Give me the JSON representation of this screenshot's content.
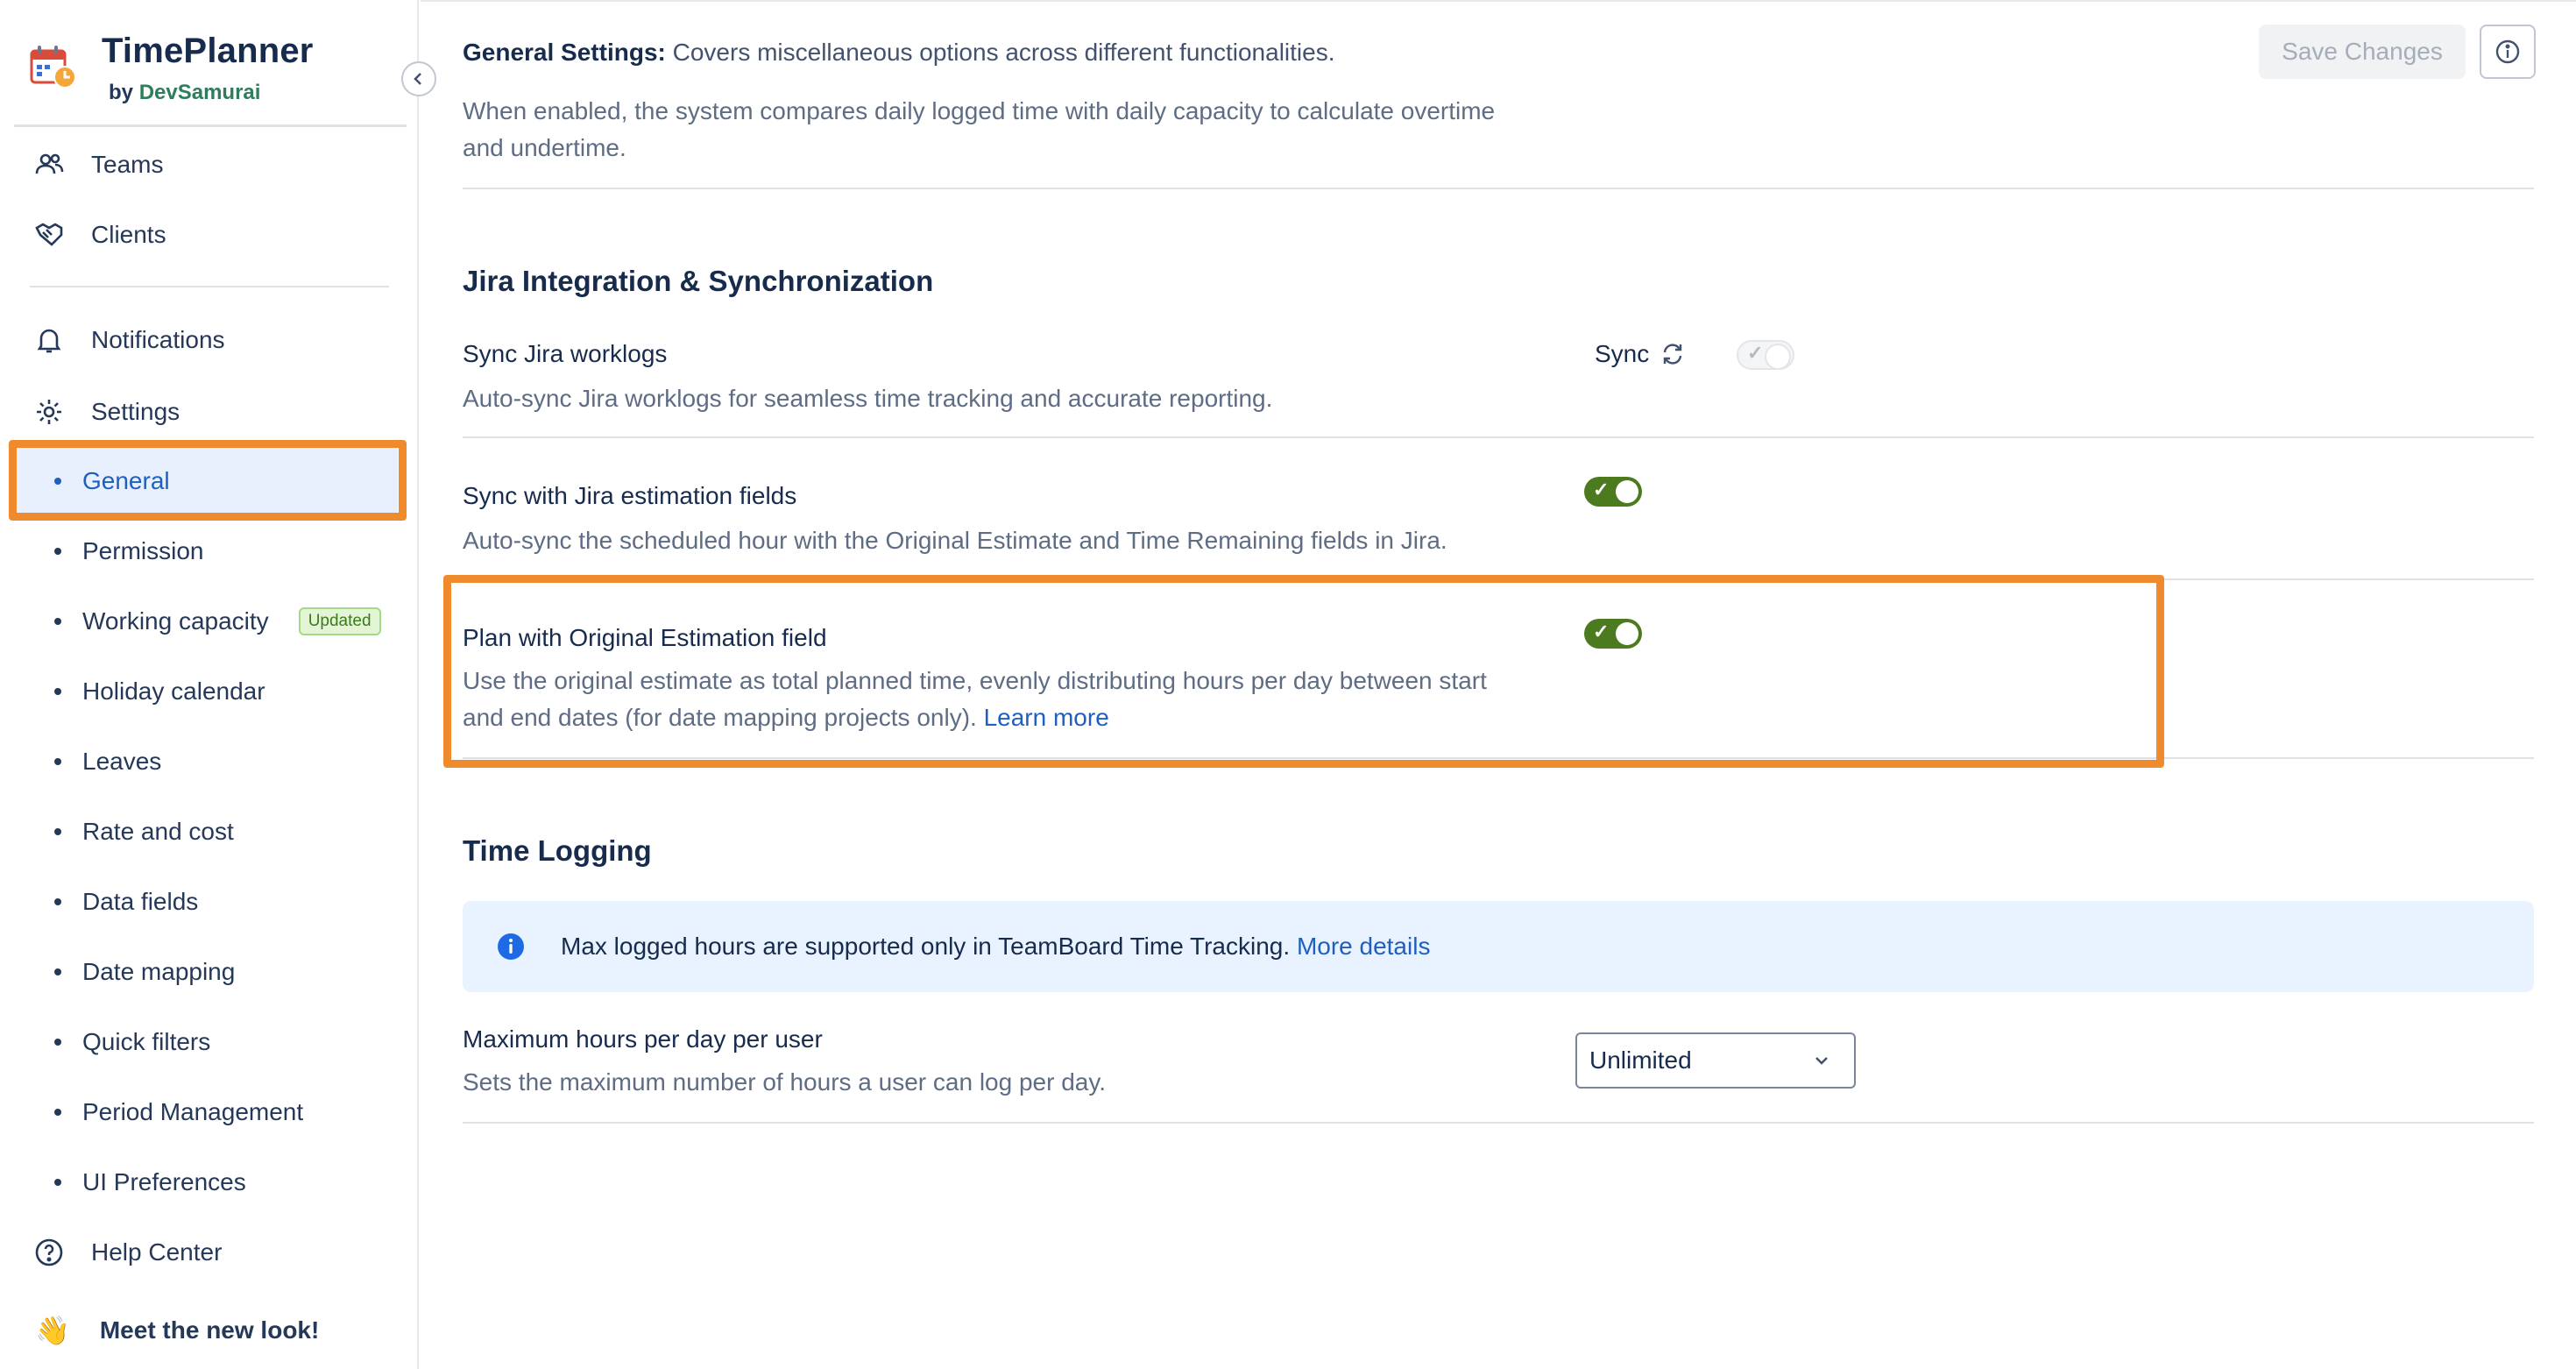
{
  "sidebar": {
    "brand": {
      "title": "TimePlanner",
      "by": "by",
      "org": "DevSamurai"
    },
    "nav_top": [
      {
        "label": "Teams",
        "icon": "users-icon"
      },
      {
        "label": "Clients",
        "icon": "handshake-icon"
      }
    ],
    "nav_mid": [
      {
        "label": "Notifications",
        "icon": "bell-icon"
      },
      {
        "label": "Settings",
        "icon": "gear-icon"
      }
    ],
    "settings_items": [
      {
        "label": "General",
        "active": true
      },
      {
        "label": "Permission"
      },
      {
        "label": "Working capacity",
        "badge": "Updated"
      },
      {
        "label": "Holiday calendar"
      },
      {
        "label": "Leaves"
      },
      {
        "label": "Rate and cost"
      },
      {
        "label": "Data fields"
      },
      {
        "label": "Date mapping"
      },
      {
        "label": "Quick filters"
      },
      {
        "label": "Period Management"
      },
      {
        "label": "UI Preferences"
      }
    ],
    "help": {
      "label": "Help Center",
      "icon": "help-circle-icon"
    },
    "meet": {
      "label": "Meet the new look!",
      "emoji": "👋"
    }
  },
  "header": {
    "heading_bold": "General Settings:",
    "heading_text": " Covers miscellaneous options across different functionalities.",
    "save_label": "Save Changes"
  },
  "overtime": {
    "desc_line1": "When enabled, the system compares daily logged time with daily capacity to calculate overtime",
    "desc_line2": "and undertime."
  },
  "jira": {
    "section_title": "Jira Integration & Synchronization",
    "sync_worklogs": {
      "title": "Sync Jira worklogs",
      "desc": "Auto-sync Jira worklogs for seamless time tracking and accurate reporting.",
      "sync_label": "Sync",
      "enabled": false
    },
    "sync_estimation": {
      "title": "Sync with Jira estimation fields",
      "desc": "Auto-sync the scheduled hour with the Original Estimate and Time Remaining fields in Jira.",
      "enabled": true
    },
    "plan_original": {
      "title": "Plan with Original Estimation field",
      "desc_line1": "Use the original estimate as total planned time, evenly distributing hours per day between start",
      "desc_line2": "and end dates (for date mapping projects only). ",
      "link": "Learn more",
      "enabled": true
    }
  },
  "time_logging": {
    "section_title": "Time Logging",
    "banner_text": "Max logged hours are supported only in TeamBoard Time Tracking. ",
    "banner_link": "More details",
    "max_hours": {
      "title": "Maximum hours per day per user",
      "desc": "Sets the maximum number of hours a user can log per day.",
      "value": "Unlimited"
    }
  },
  "colors": {
    "accent_highlight": "#f08b2d",
    "toggle_on": "#4c7a1f",
    "link": "#1f5fbf",
    "banner_bg": "#e9f2ff"
  }
}
